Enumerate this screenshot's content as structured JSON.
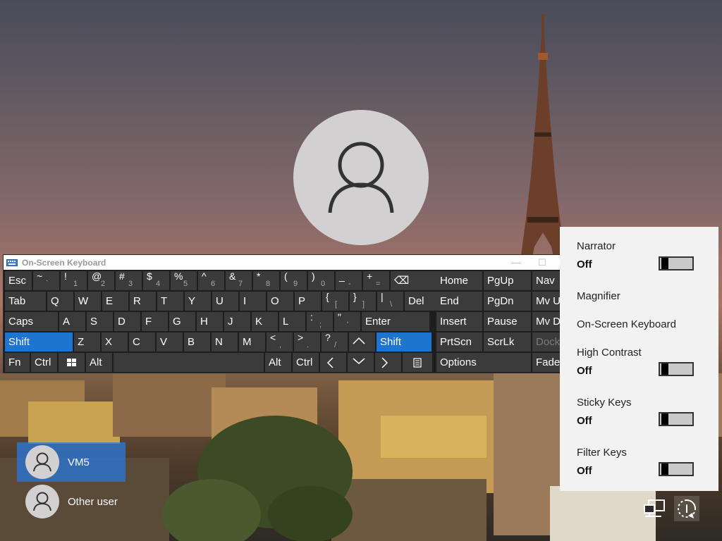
{
  "osk": {
    "title": "On-Screen Keyboard",
    "controls": {
      "minimize": "—",
      "maximize": "☐",
      "close": "✕"
    },
    "row1": [
      {
        "label": "Esc"
      },
      {
        "top": "~",
        "bot": "`"
      },
      {
        "top": "!",
        "bot": "1"
      },
      {
        "top": "@",
        "bot": "2"
      },
      {
        "top": "#",
        "bot": "3"
      },
      {
        "top": "$",
        "bot": "4"
      },
      {
        "top": "%",
        "bot": "5"
      },
      {
        "top": "^",
        "bot": "6"
      },
      {
        "top": "&",
        "bot": "7"
      },
      {
        "top": "*",
        "bot": "8"
      },
      {
        "top": "(",
        "bot": "9"
      },
      {
        "top": ")",
        "bot": "0"
      },
      {
        "top": "_",
        "bot": "-"
      },
      {
        "top": "+",
        "bot": "="
      },
      {
        "label": "⌫"
      }
    ],
    "row2": [
      "Tab",
      "Q",
      "W",
      "E",
      "R",
      "T",
      "Y",
      "U",
      "I",
      "O",
      "P"
    ],
    "row2_sym": [
      {
        "top": "{",
        "bot": "["
      },
      {
        "top": "}",
        "bot": "]"
      },
      {
        "top": "|",
        "bot": "\\"
      }
    ],
    "row2_end": "Del",
    "row3": [
      "Caps",
      "A",
      "S",
      "D",
      "F",
      "G",
      "H",
      "J",
      "K",
      "L"
    ],
    "row3_sym": [
      {
        "top": ":",
        "bot": ";"
      },
      {
        "top": "\"",
        "bot": "'"
      }
    ],
    "row3_end": "Enter",
    "row4_shift_left": "Shift",
    "row4": [
      "Z",
      "X",
      "C",
      "V",
      "B",
      "N",
      "M"
    ],
    "row4_sym": [
      {
        "top": "<",
        "bot": ","
      },
      {
        "top": ">",
        "bot": "."
      },
      {
        "top": "?",
        "bot": "/"
      }
    ],
    "row4_up": "^",
    "row4_shift_right": "Shift",
    "row5": {
      "fn": "Fn",
      "ctrl": "Ctrl",
      "alt": "Alt",
      "alt_r": "Alt",
      "ctrl_r": "Ctrl"
    },
    "nav_keys": [
      [
        "Home",
        "PgUp",
        "Nav"
      ],
      [
        "End",
        "PgDn",
        "Mv Up"
      ],
      [
        "Insert",
        "Pause",
        "Mv Dn"
      ],
      [
        "PrtScn",
        "ScrLk",
        "Dock"
      ]
    ],
    "options": "Options",
    "fade": "Fade"
  },
  "flyout": {
    "items": [
      {
        "label": "Narrator",
        "state": "Off",
        "on": false
      },
      {
        "label": "Magnifier"
      },
      {
        "label": "On-Screen Keyboard"
      },
      {
        "label": "High Contrast",
        "state": "Off",
        "on": false
      },
      {
        "label": "Sticky Keys",
        "state": "Off",
        "on": false
      },
      {
        "label": "Filter Keys",
        "state": "Off",
        "on": false
      }
    ]
  },
  "users": [
    {
      "name": "VM5",
      "selected": true
    },
    {
      "name": "Other user",
      "selected": false
    }
  ],
  "colors": {
    "accent": "#1d75d0",
    "key_bg": "#3b3b3b",
    "flyout_bg": "#f2f2f2"
  },
  "icons": {
    "network": "network-icon",
    "accessibility": "ease-of-access-icon",
    "power": "power-icon"
  }
}
